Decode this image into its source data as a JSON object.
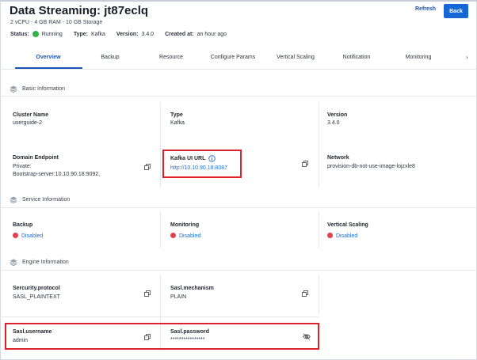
{
  "header": {
    "title": "Data Streaming: jt87eclq",
    "specs": "2 vCPU - 4 GB RAM - 10 GB Storage",
    "status_label": "Status:",
    "status_value": "Running",
    "type_label": "Type:",
    "type_value": "Kafka",
    "version_label": "Version:",
    "version_value": "3.4.0",
    "created_label": "Created at:",
    "created_value": "an hour ago",
    "refresh_label": "Refresh",
    "back_label": "Back"
  },
  "tabs": [
    "Overview",
    "Backup",
    "Resource",
    "Configure Params",
    "Vertical Scaling",
    "Notification",
    "Monitoring"
  ],
  "active_tab": "Overview",
  "tab_next_glyph": "›",
  "basic": {
    "heading": "Basic Information",
    "cluster_name_label": "Cluster Name",
    "cluster_name_value": "userguide-2",
    "type_label": "Type",
    "type_value": "Kafka",
    "version_label": "Version",
    "version_value": "3.4.0",
    "endpoint_label": "Domain Endpoint",
    "endpoint_line1": "Private:",
    "endpoint_line2": "Bootstrap-server:10.10.90.18:9092,",
    "kafka_ui_label": "Kafka UI URL",
    "kafka_ui_value": "http://10.10.90.18:8087",
    "network_label": "Network",
    "network_value": "provision-db-not-use-image-lojzxle8"
  },
  "service": {
    "heading": "Service Information",
    "backup_label": "Backup",
    "backup_value": "Disabled",
    "monitoring_label": "Monitoring",
    "monitoring_value": "Disabled",
    "vscaling_label": "Vertical Scaling",
    "vscaling_value": "Disabled"
  },
  "engine": {
    "heading": "Engine Information",
    "security_label": "Sercurity.protocol",
    "security_value": "SASL_PLAINTEXT",
    "mechanism_label": "Sasl.mechanism",
    "mechanism_value": "PLAIN",
    "username_label": "Sasl.username",
    "username_value": "admin",
    "password_label": "Sasl.password",
    "password_value": "****************"
  },
  "colors": {
    "accent": "#1668d6",
    "running": "#2fb344",
    "disabled": "#e0424f",
    "highlight": "#d8232a"
  }
}
